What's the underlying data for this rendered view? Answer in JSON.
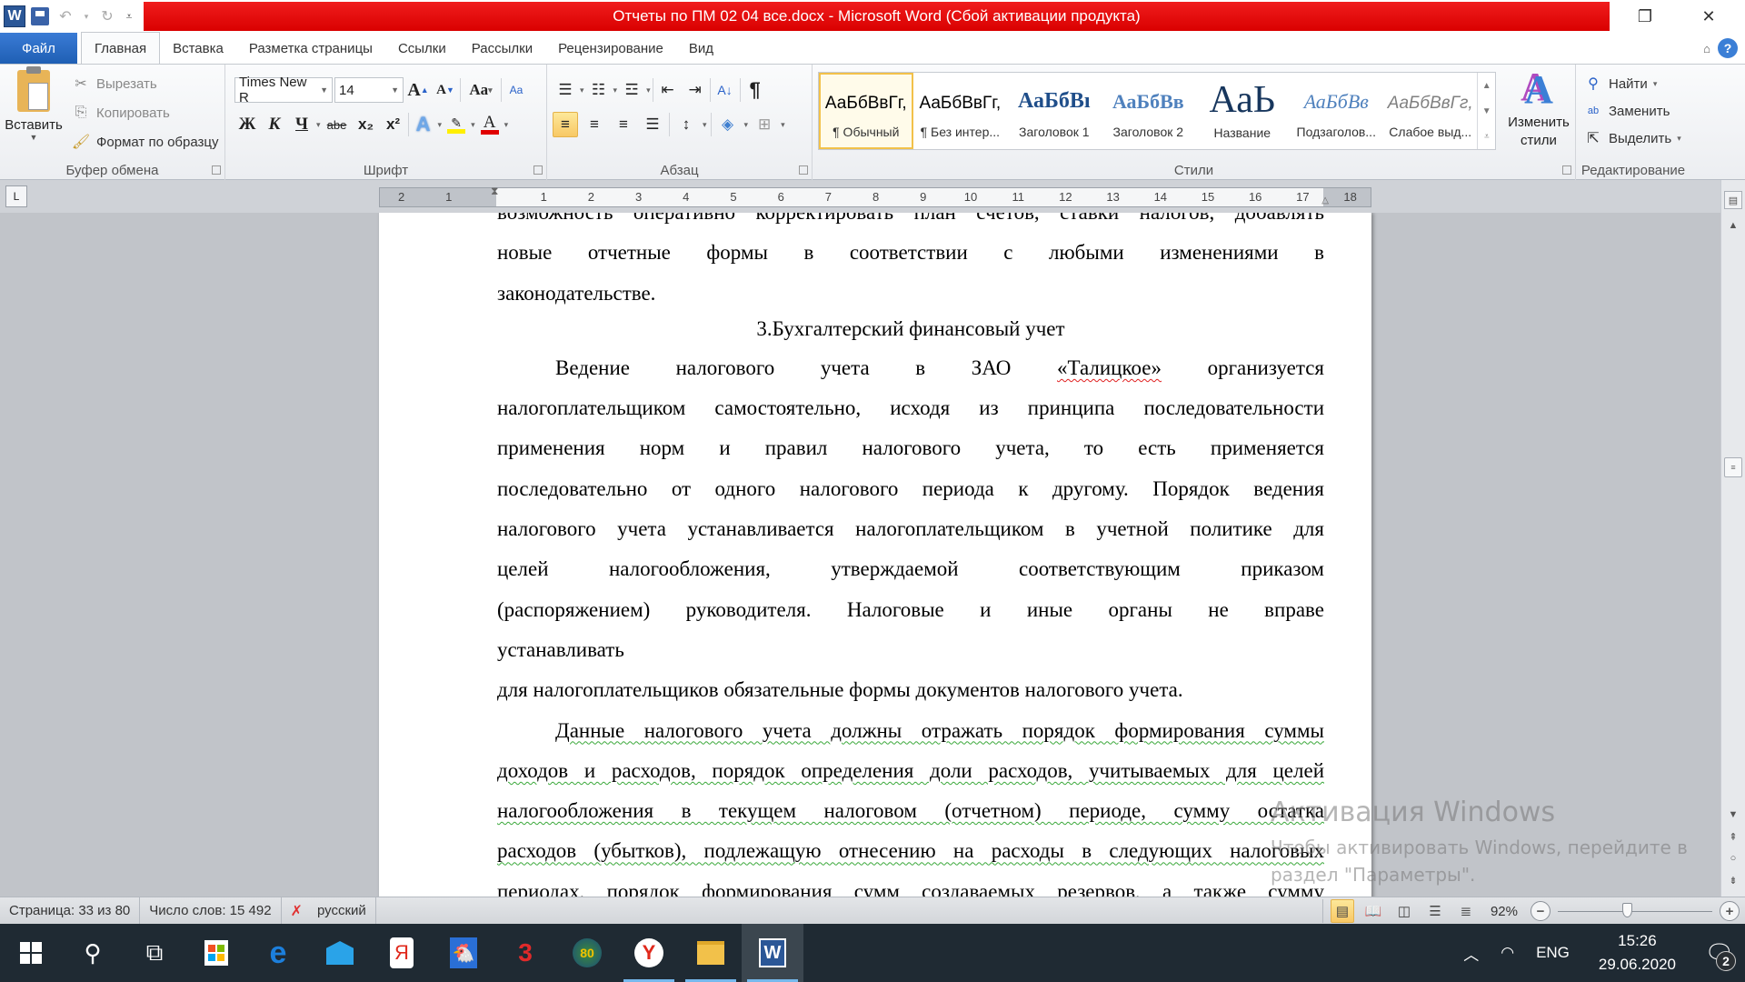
{
  "titlebar": {
    "title": "Отчеты по ПМ 02 04 все.docx - Microsoft Word (Сбой активации продукта)",
    "accent_color": "#e00b0b",
    "qat": [
      "word-logo-icon",
      "save-icon",
      "undo-icon",
      "redo-icon",
      "customize-qat-icon"
    ]
  },
  "tabs": {
    "file": "Файл",
    "items": [
      "Главная",
      "Вставка",
      "Разметка страницы",
      "Ссылки",
      "Рассылки",
      "Рецензирование",
      "Вид"
    ],
    "active": "Главная"
  },
  "ribbon": {
    "clipboard": {
      "label": "Буфер обмена",
      "paste": "Вставить",
      "cut": "Вырезать",
      "copy": "Копировать",
      "format_painter": "Формат по образцу"
    },
    "font": {
      "label": "Шрифт",
      "font_name": "Times New R",
      "font_size": "14",
      "bold": "Ж",
      "italic": "К",
      "underline": "Ч",
      "strikethrough": "abe",
      "subscript": "x₂",
      "superscript": "x²",
      "change_case": "Aa",
      "grow": "A",
      "shrink": "A"
    },
    "paragraph": {
      "label": "Абзац",
      "pilcrow": "¶"
    },
    "styles": {
      "label": "Стили",
      "items": [
        {
          "preview": "АаБбВвГг,",
          "name": "¶ Обычный",
          "selected": true
        },
        {
          "preview": "АаБбВвГг,",
          "name": "¶ Без интер..."
        },
        {
          "preview": "АаБбВı",
          "name": "Заголовок 1"
        },
        {
          "preview": "АаБбВв",
          "name": "Заголовок 2"
        },
        {
          "preview": "АаЬ",
          "name": "Название"
        },
        {
          "preview": "АаБбВв",
          "name": "Подзаголов..."
        },
        {
          "preview": "АаБбВвГг,",
          "name": "Слабое выд..."
        }
      ],
      "change_styles": "Изменить стили"
    },
    "editing": {
      "label": "Редактирование",
      "find": "Найти",
      "replace": "Заменить",
      "select": "Выделить"
    }
  },
  "ruler": {
    "left_numbers": [
      "2",
      "1"
    ],
    "numbers": [
      "1",
      "2",
      "3",
      "4",
      "5",
      "6",
      "7",
      "8",
      "9",
      "10",
      "11",
      "12",
      "13",
      "14",
      "15",
      "16",
      "17"
    ],
    "right_numbers": [
      "18"
    ]
  },
  "document": {
    "lines_top": [
      "возможность оперативно корректировать план счетов, ставки налогов, добавлять",
      "новые отчетные формы в соответствии с любыми изменениями в",
      "законодательстве."
    ],
    "heading": "3.Бухгалтерский финансовый учет",
    "para1_lines": [
      "Ведение налогового учета в ЗАО «Талицкое» организуется",
      "налогоплательщиком самостоятельно, исходя из принципа последовательности",
      "применения норм и правил налогового учета, то есть применяется",
      "последовательно от одного налогового периода к другому. Порядок ведения",
      "налогового учета устанавливается налогоплательщиком в учетной политике для",
      "целей налогообложения, утверждаемой соответствующим приказом",
      "(распоряжением) руководителя. Налоговые и иные органы не вправе",
      "устанавливать"
    ],
    "para1_tail": "для налогоплательщиков обязательные формы документов налогового учета.",
    "para2_lines": [
      "Данные налогового учета должны отражать порядок формирования суммы",
      "доходов и расходов, порядок определения доли расходов, учитываемых для целей",
      "налогообложения в текущем налоговом (отчетном) периоде, сумму остатка",
      "расходов (убытков), подлежащую отнесению на расходы в следующих налоговых",
      "периодах, порядок формирования сумм создаваемых резервов, а также сумму"
    ]
  },
  "watermark": {
    "title": "Активация Windows",
    "line1": "Чтобы активировать Windows, перейдите в",
    "line2": "раздел \"Параметры\"."
  },
  "statusbar": {
    "page": "Страница: 33 из 80",
    "words": "Число слов: 15 492",
    "language": "русский",
    "zoom": "92%",
    "zoom_percent": 92
  },
  "taskbar": {
    "apps": [
      "start-icon",
      "search-icon",
      "task-view-icon",
      "store-icon",
      "edge-icon",
      "mail-icon",
      "yandex-browser-icon",
      "game-chicken-icon",
      "game-3-icon",
      "game-80-icon",
      "yandex-icon",
      "file-explorer-icon",
      "word-icon"
    ],
    "language": "ENG",
    "time": "15:26",
    "date": "29.06.2020",
    "notifications": "2"
  }
}
